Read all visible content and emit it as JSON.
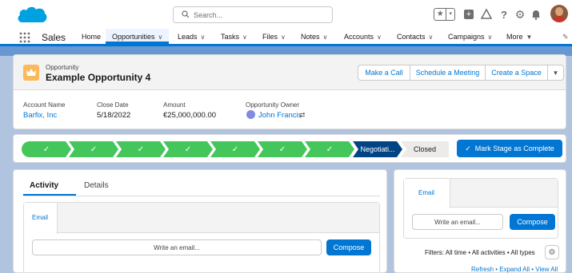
{
  "header_bar": {
    "search_placeholder": "Search...",
    "icons": [
      "favorites-star-icon",
      "favorites-dropdown-icon",
      "global-create-icon",
      "trailhead-icon",
      "help-icon",
      "setup-gear-icon",
      "notifications-bell-icon",
      "user-avatar"
    ]
  },
  "nav": {
    "app_name": "Sales",
    "items": [
      {
        "label": "Home",
        "chevron": false
      },
      {
        "label": "Opportunities",
        "chevron": true,
        "active": true
      },
      {
        "label": "Leads",
        "chevron": true
      },
      {
        "label": "Tasks",
        "chevron": true
      },
      {
        "label": "Files",
        "chevron": true
      },
      {
        "label": "Notes",
        "chevron": true
      },
      {
        "label": "Accounts",
        "chevron": true
      },
      {
        "label": "Contacts",
        "chevron": true
      },
      {
        "label": "Campaigns",
        "chevron": true
      },
      {
        "label": "More",
        "chevron": true
      }
    ]
  },
  "record": {
    "object_label": "Opportunity",
    "name": "Example Opportunity 4",
    "actions": [
      "Make a Call",
      "Schedule a Meeting",
      "Create a Space"
    ],
    "fields": [
      {
        "label": "Account Name",
        "value": "Barfix, Inc"
      },
      {
        "label": "Close Date",
        "value": "5/18/2022"
      },
      {
        "label": "Amount",
        "value": "€25,000,000.00"
      },
      {
        "label": "Opportunity Owner",
        "value": "John Francis"
      }
    ]
  },
  "path": {
    "completed_count": 7,
    "current_stage": "Negotiati...",
    "closed_label": "Closed",
    "complete_button": "Mark Stage as Complete"
  },
  "activity": {
    "tabs": [
      "Activity",
      "Details"
    ],
    "email_tab": "Email",
    "email_placeholder": "Write an email...",
    "compose_label": "Compose"
  },
  "right_panel": {
    "email_tab": "Email",
    "email_placeholder": "Write an email...",
    "compose_label": "Compose",
    "filters_text": "Filters: All time • All activities • All types",
    "links_text": "Refresh • Expand All • View All"
  },
  "colors": {
    "brand_blue": "#0176d3",
    "stage_green": "#45c65a",
    "stage_current": "#014486",
    "opportunity_icon": "#fcb95b"
  }
}
